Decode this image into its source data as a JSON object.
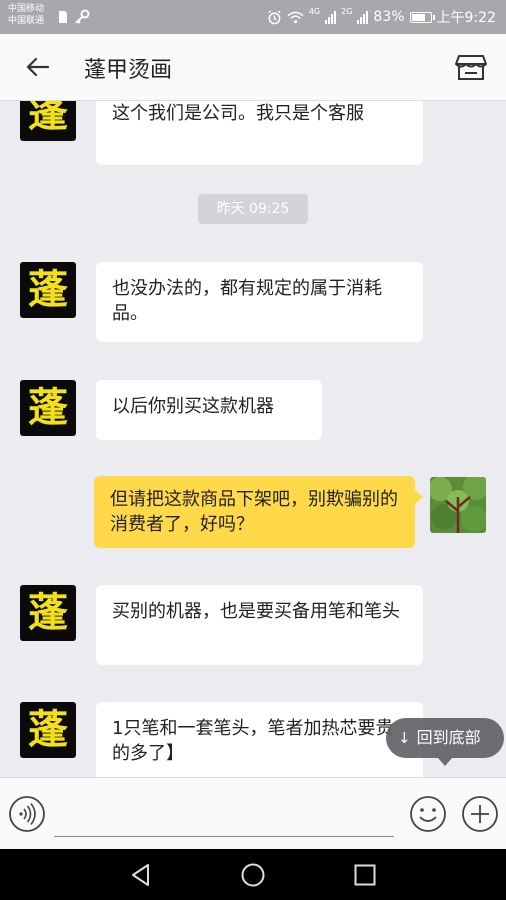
{
  "status_bar": {
    "carrier1": "中国移动",
    "carrier2": "中国联通",
    "network1": "4G",
    "network2": "2G",
    "battery": "83%",
    "battery_level": 0.83,
    "time": "上午9:22"
  },
  "header": {
    "title": "蓬甲烫画",
    "back_icon": "arrow-left-icon",
    "store_icon": "store-icon"
  },
  "colors": {
    "my_bubble": "#ffd94a",
    "their_bubble": "#ffffff",
    "avatar_text": "#f3e018",
    "background": "#ececf0"
  },
  "chat": {
    "avatar_char": "蓬",
    "timestamp": "昨天 09:25",
    "messages": [
      {
        "sender": "other",
        "text": "这个我们是公司。我只是个客服"
      },
      {
        "sender": "other",
        "text": "也没办法的，都有规定的属于消耗品。"
      },
      {
        "sender": "other",
        "text": "以后你别买这款机器"
      },
      {
        "sender": "me",
        "text": "但请把这款商品下架吧，别欺骗别的消费者了，好吗？"
      },
      {
        "sender": "other",
        "text": "买别的机器，也是要买备用笔和笔头"
      },
      {
        "sender": "other",
        "text": "1只笔和一套笔头，笔者加热芯要贵的多了】"
      }
    ]
  },
  "jump_button": {
    "label": "回到底部",
    "icon": "arrow-down-icon"
  },
  "input_bar": {
    "placeholder": "",
    "voice_icon": "voice-icon",
    "emoji_icon": "emoji-icon",
    "plus_icon": "plus-icon"
  },
  "nav_bar": {
    "back_icon": "triangle-back-icon",
    "home_icon": "circle-home-icon",
    "recents_icon": "square-recents-icon"
  }
}
